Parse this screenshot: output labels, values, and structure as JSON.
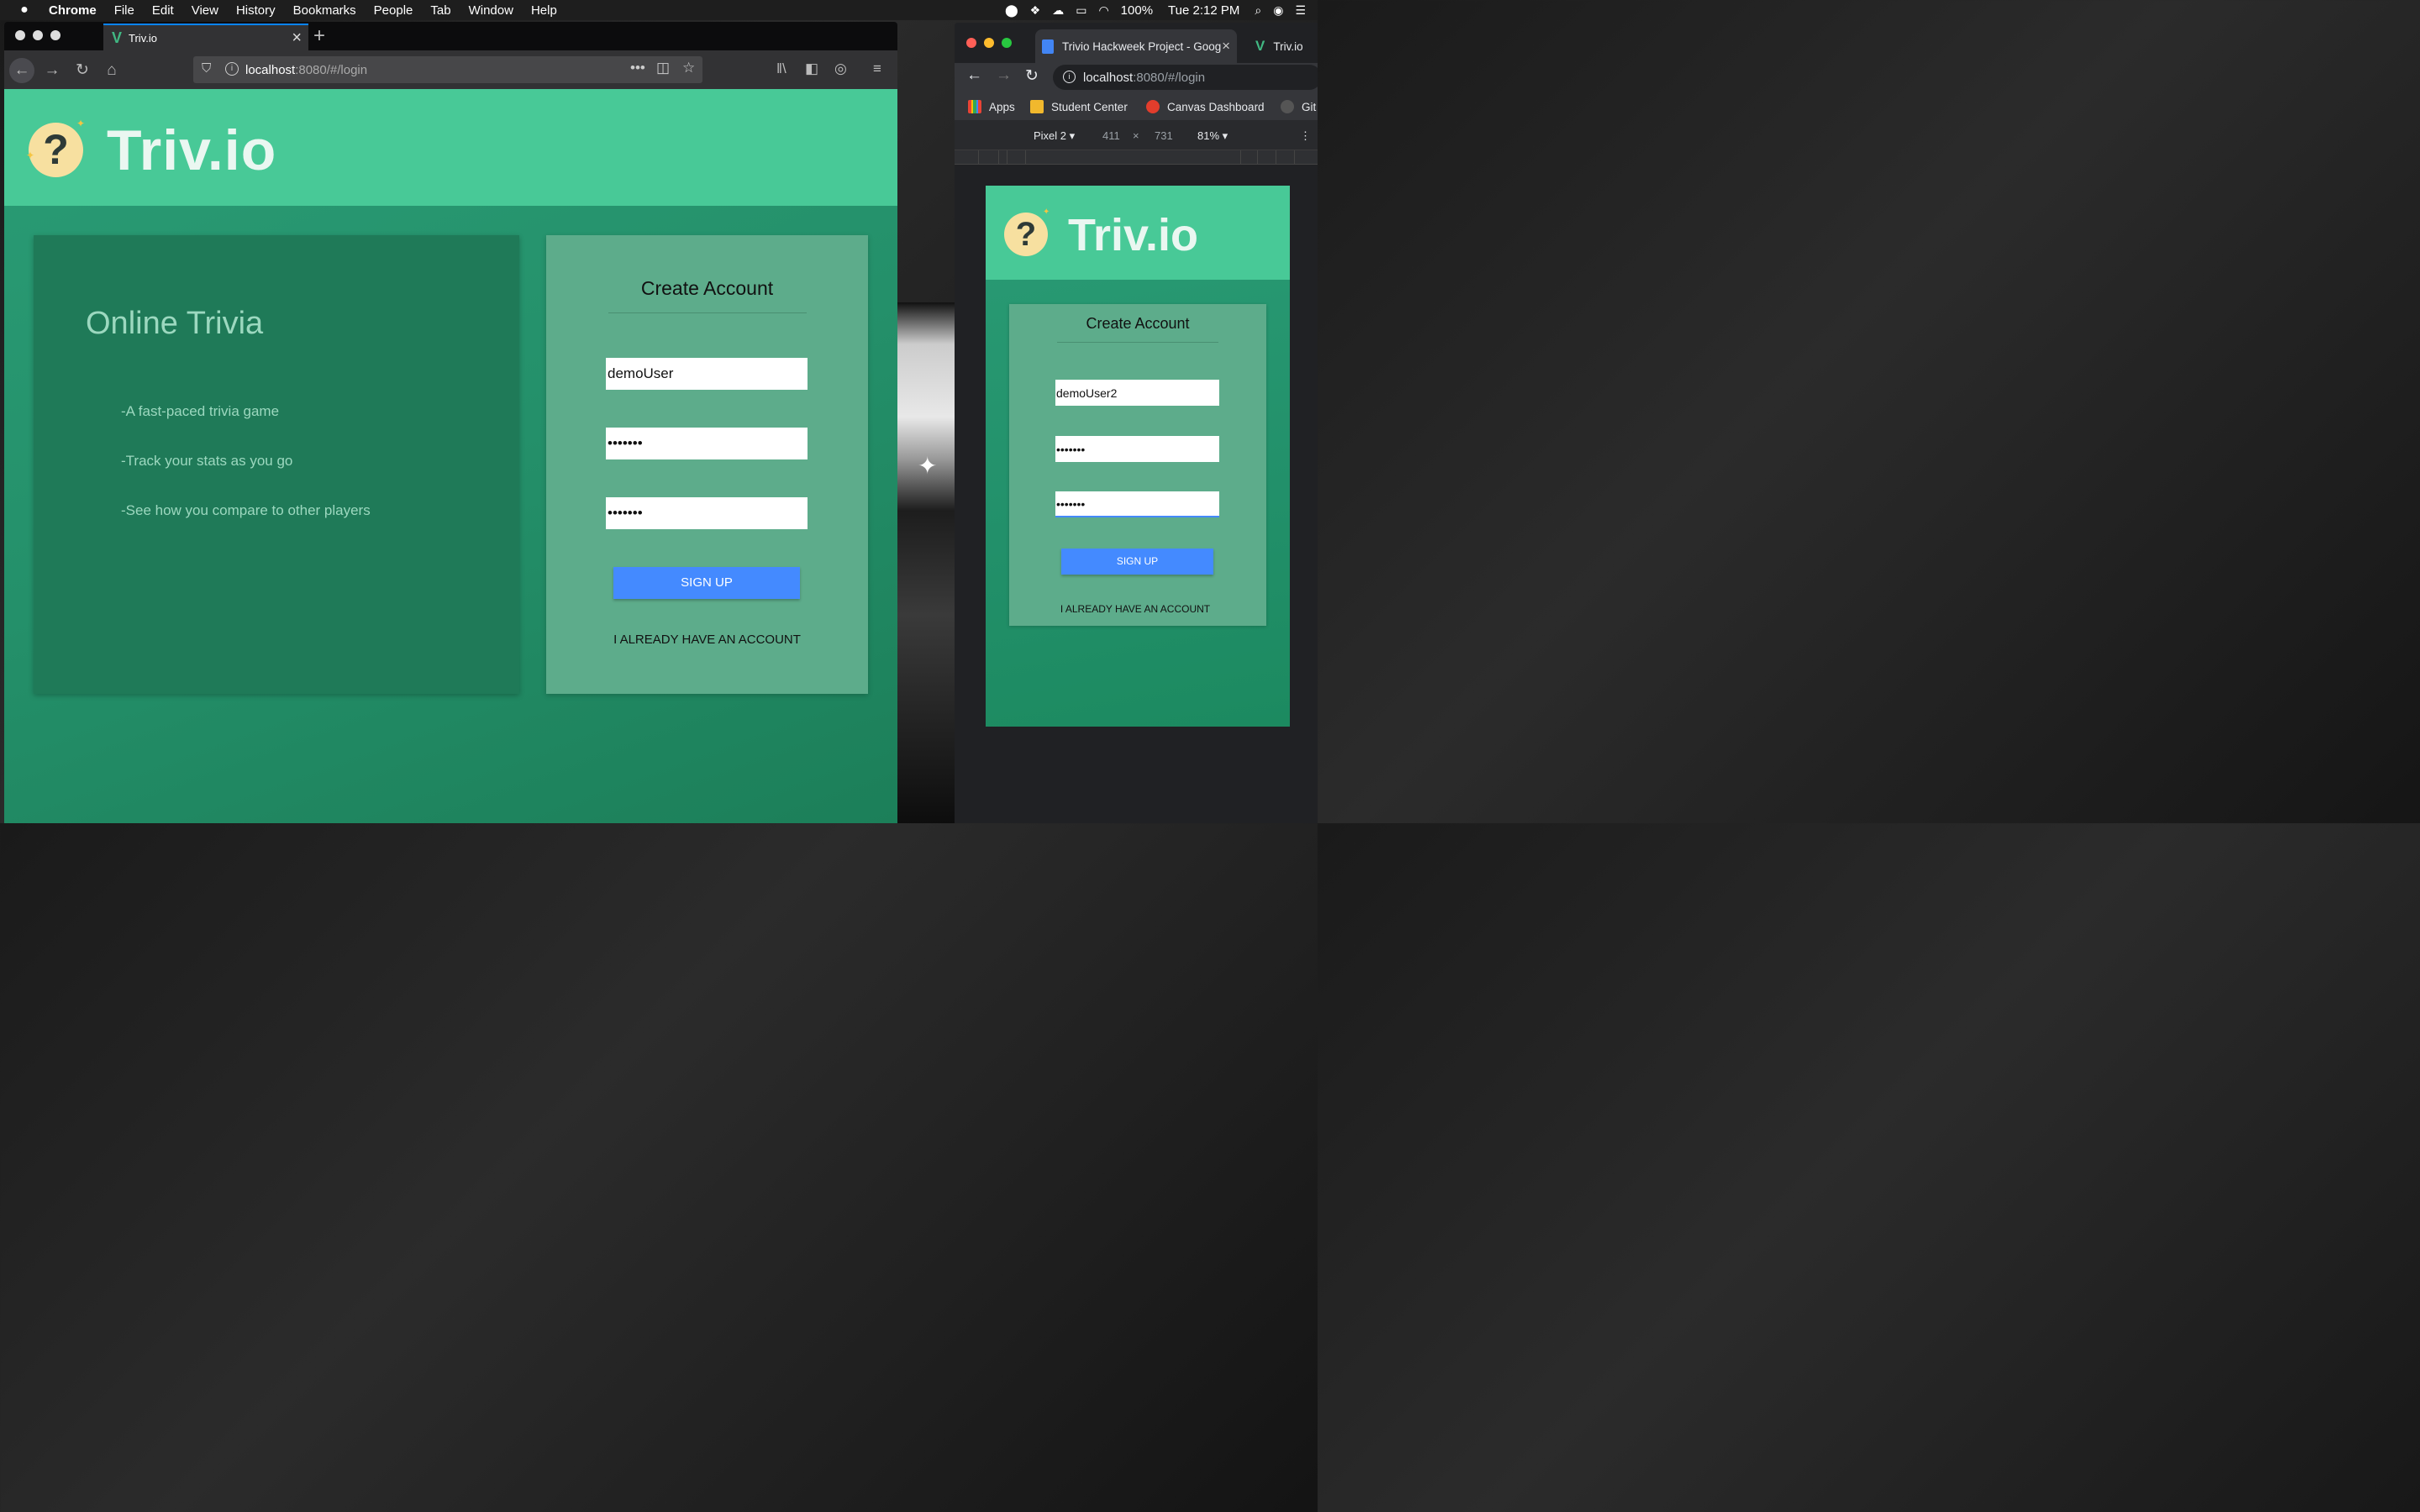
{
  "menubar": {
    "app": "Chrome",
    "items": [
      "File",
      "Edit",
      "View",
      "History",
      "Bookmarks",
      "People",
      "Tab",
      "Window",
      "Help"
    ],
    "battery": "100%",
    "clock": "Tue 2:12 PM"
  },
  "firefox": {
    "tab_title": "Triv.io",
    "url_host": "localhost",
    "url_path": ":8080/#/login"
  },
  "site": {
    "brand": "Triv.io",
    "logo_glyph": "?",
    "info_title": "Online Trivia",
    "info_lines": [
      "-A fast-paced trivia game",
      "-Track your stats as you go",
      "-See how you compare to other players"
    ],
    "form_title": "Create Account",
    "username_value": "demoUser",
    "password_mask": "•••••••",
    "confirm_mask": "•••••••",
    "signup_label": "SIGN UP",
    "login_link": "I ALREADY HAVE AN ACCOUNT"
  },
  "chrome": {
    "tab1_title": "Trivio Hackweek Project - Goog",
    "tab2_title": "Triv.io",
    "url_host": "localhost",
    "url_path": ":8080/#/login",
    "bookmarks": [
      "Apps",
      "Student Center",
      "Canvas Dashboard",
      "Git"
    ],
    "device": "Pixel 2",
    "width": "411",
    "height": "731",
    "zoom": "81%"
  },
  "mobile": {
    "username_value": "demoUser2"
  },
  "colors": {
    "header_green": "#48c997",
    "page_green": "#2a9c75",
    "info_card": "#1f7a58",
    "form_card": "#5dac8b",
    "button_blue": "#448aff"
  }
}
